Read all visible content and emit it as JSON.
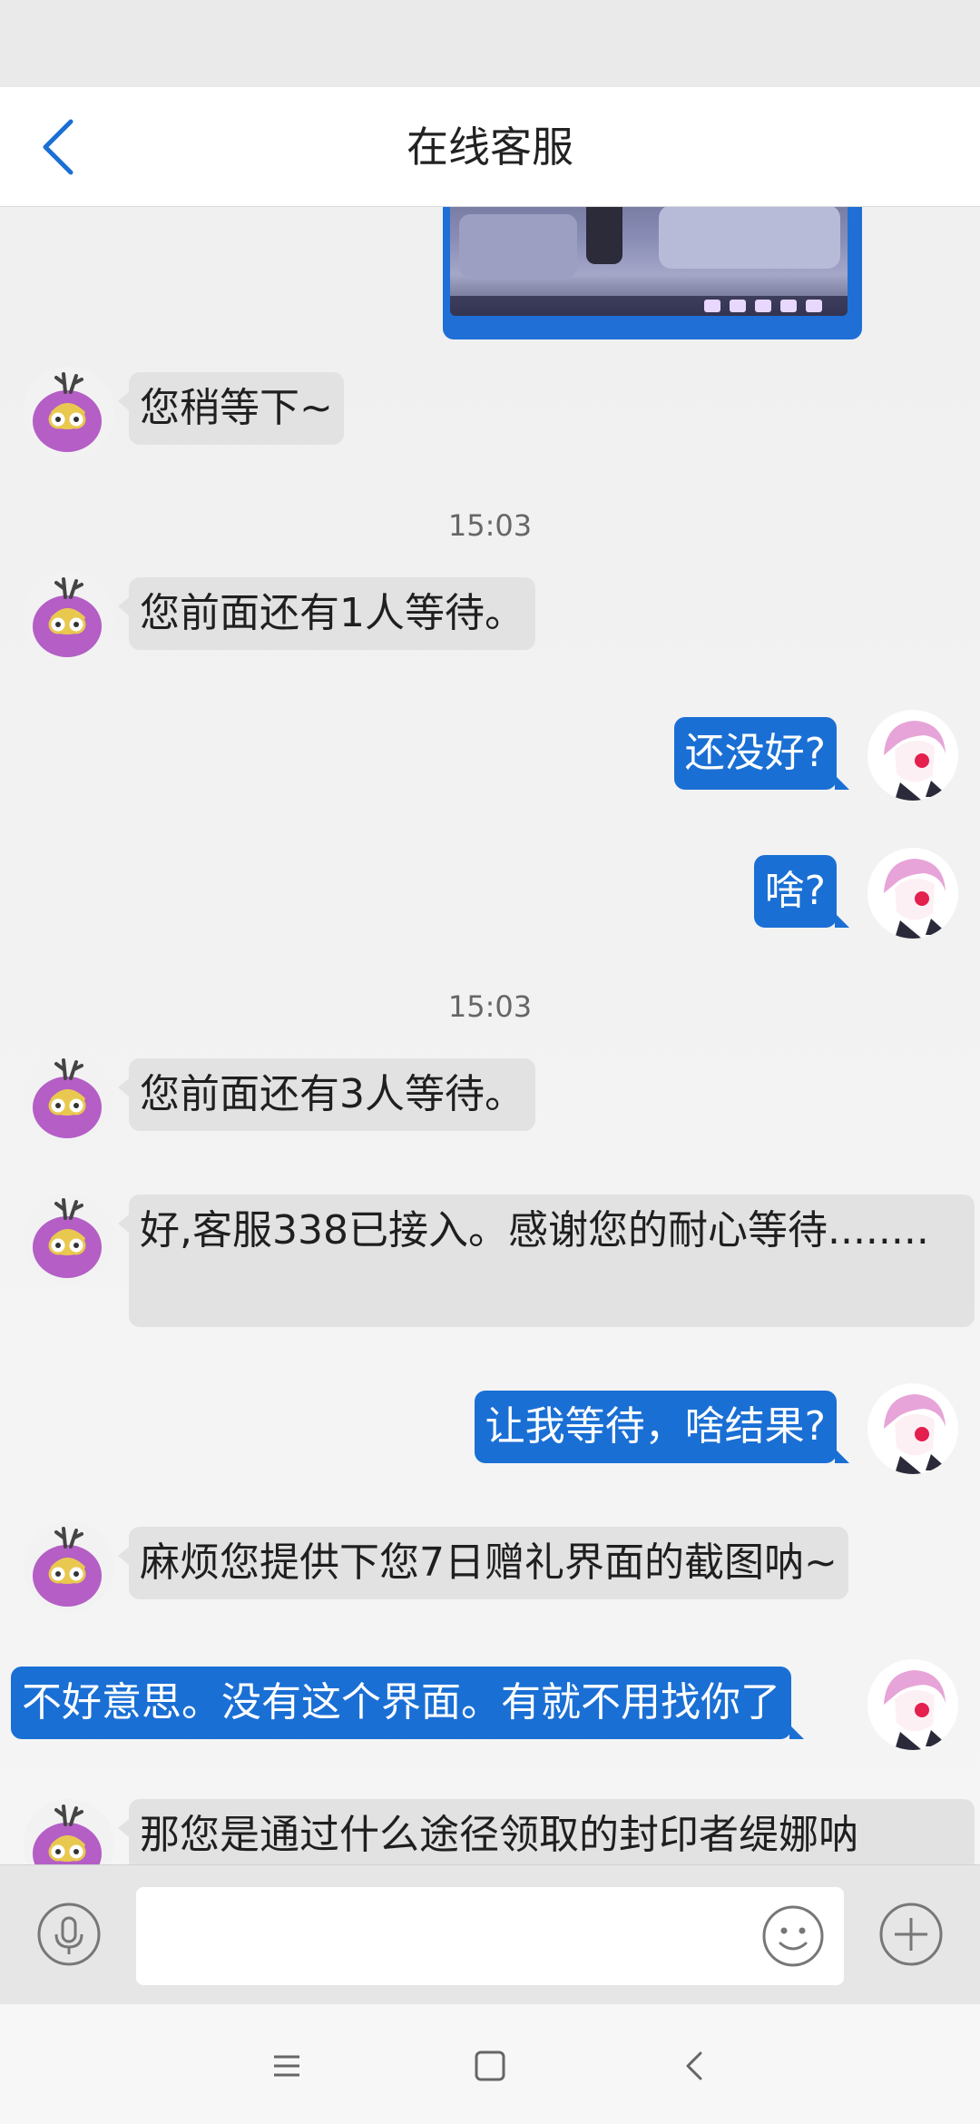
{
  "header": {
    "title": "在线客服"
  },
  "chat": {
    "messages": [
      {
        "side": "left",
        "text": "您稍等下~"
      },
      {
        "type": "time",
        "text": "15:03"
      },
      {
        "side": "left",
        "text": "您前面还有1人等待。"
      },
      {
        "side": "right",
        "text": "还没好?"
      },
      {
        "side": "right",
        "text": "啥?"
      },
      {
        "type": "time",
        "text": "15:03"
      },
      {
        "side": "left",
        "text": "您前面还有3人等待。"
      },
      {
        "side": "left",
        "text": "好,客服338已接入。感谢您的耐心等待........"
      },
      {
        "side": "right",
        "text": "让我等待，啥结果?"
      },
      {
        "side": "left",
        "text": "麻烦您提供下您7日赠礼界面的截图呐~"
      },
      {
        "side": "right",
        "text": "不好意思。没有这个界面。有就不用找你了"
      },
      {
        "side": "left",
        "text": "那您是通过什么途径领取的封印者缇娜呐"
      }
    ]
  },
  "input_bar": {
    "value": ""
  },
  "icons": {
    "back": "chevron-left-icon",
    "mic": "microphone-icon",
    "emoji": "smiley-icon",
    "plus": "plus-icon",
    "menu": "menu-icon",
    "home": "home-square-icon",
    "nav_back": "nav-back-icon"
  },
  "colors": {
    "accent_blue": "#1a6fd4",
    "left_bubble": "#e2e2e2",
    "background": "#efefef"
  }
}
